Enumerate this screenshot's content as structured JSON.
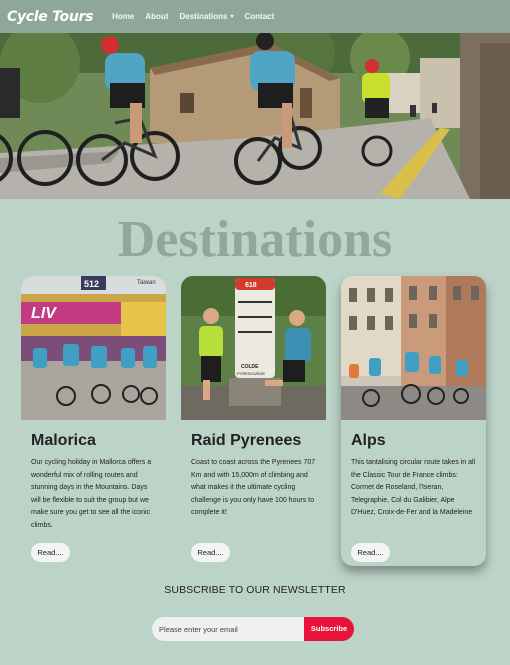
{
  "navbar": {
    "brand": "Cycle Tours",
    "links": [
      {
        "label": "Home"
      },
      {
        "label": "About"
      },
      {
        "label": "Destinations"
      },
      {
        "label": "Contact"
      }
    ]
  },
  "main": {
    "title": "Destinations",
    "cards": [
      {
        "title": "Malorica",
        "text": "Our cycling holiday in Mallorca offers a wonderful mix of rolling routes and stunning days in the Mountains. Days will be flexible to suit the group but we make sure you get to see all the iconic climbs.",
        "button": "Read....",
        "image_labels": [
          "512",
          "Taiwan",
          "LIV"
        ]
      },
      {
        "title": "Raid Pyrenees",
        "text": "Coast to coast across the Pyrenees 707 Km and with 15,000m of climbing and what makes it the ultimate cycling challenge is you only have 100 hours to complete it!",
        "button": "Read....",
        "image_labels": [
          "618",
          "COLDE",
          "PYRESOURDE"
        ]
      },
      {
        "title": "Alps",
        "text": "This tantalising circular route takes in all the Classic Tour de France climbs: Cormet de Roseland, l'Iseran, Telegraphie, Col du Galibier, Alpe D'Huez, Croix-de-Fer and la Madeleine",
        "button": "Read....",
        "image_labels": []
      }
    ]
  },
  "newsletter": {
    "title": "SUBSCRIBE TO OUR NEWSLETTER",
    "placeholder": "Please enter your email",
    "button": "Subscribe"
  },
  "colors": {
    "background": "#bcd3c8",
    "navbar": "#8fa79b",
    "title": "#90a79c",
    "subscribe": "#e8133a"
  }
}
